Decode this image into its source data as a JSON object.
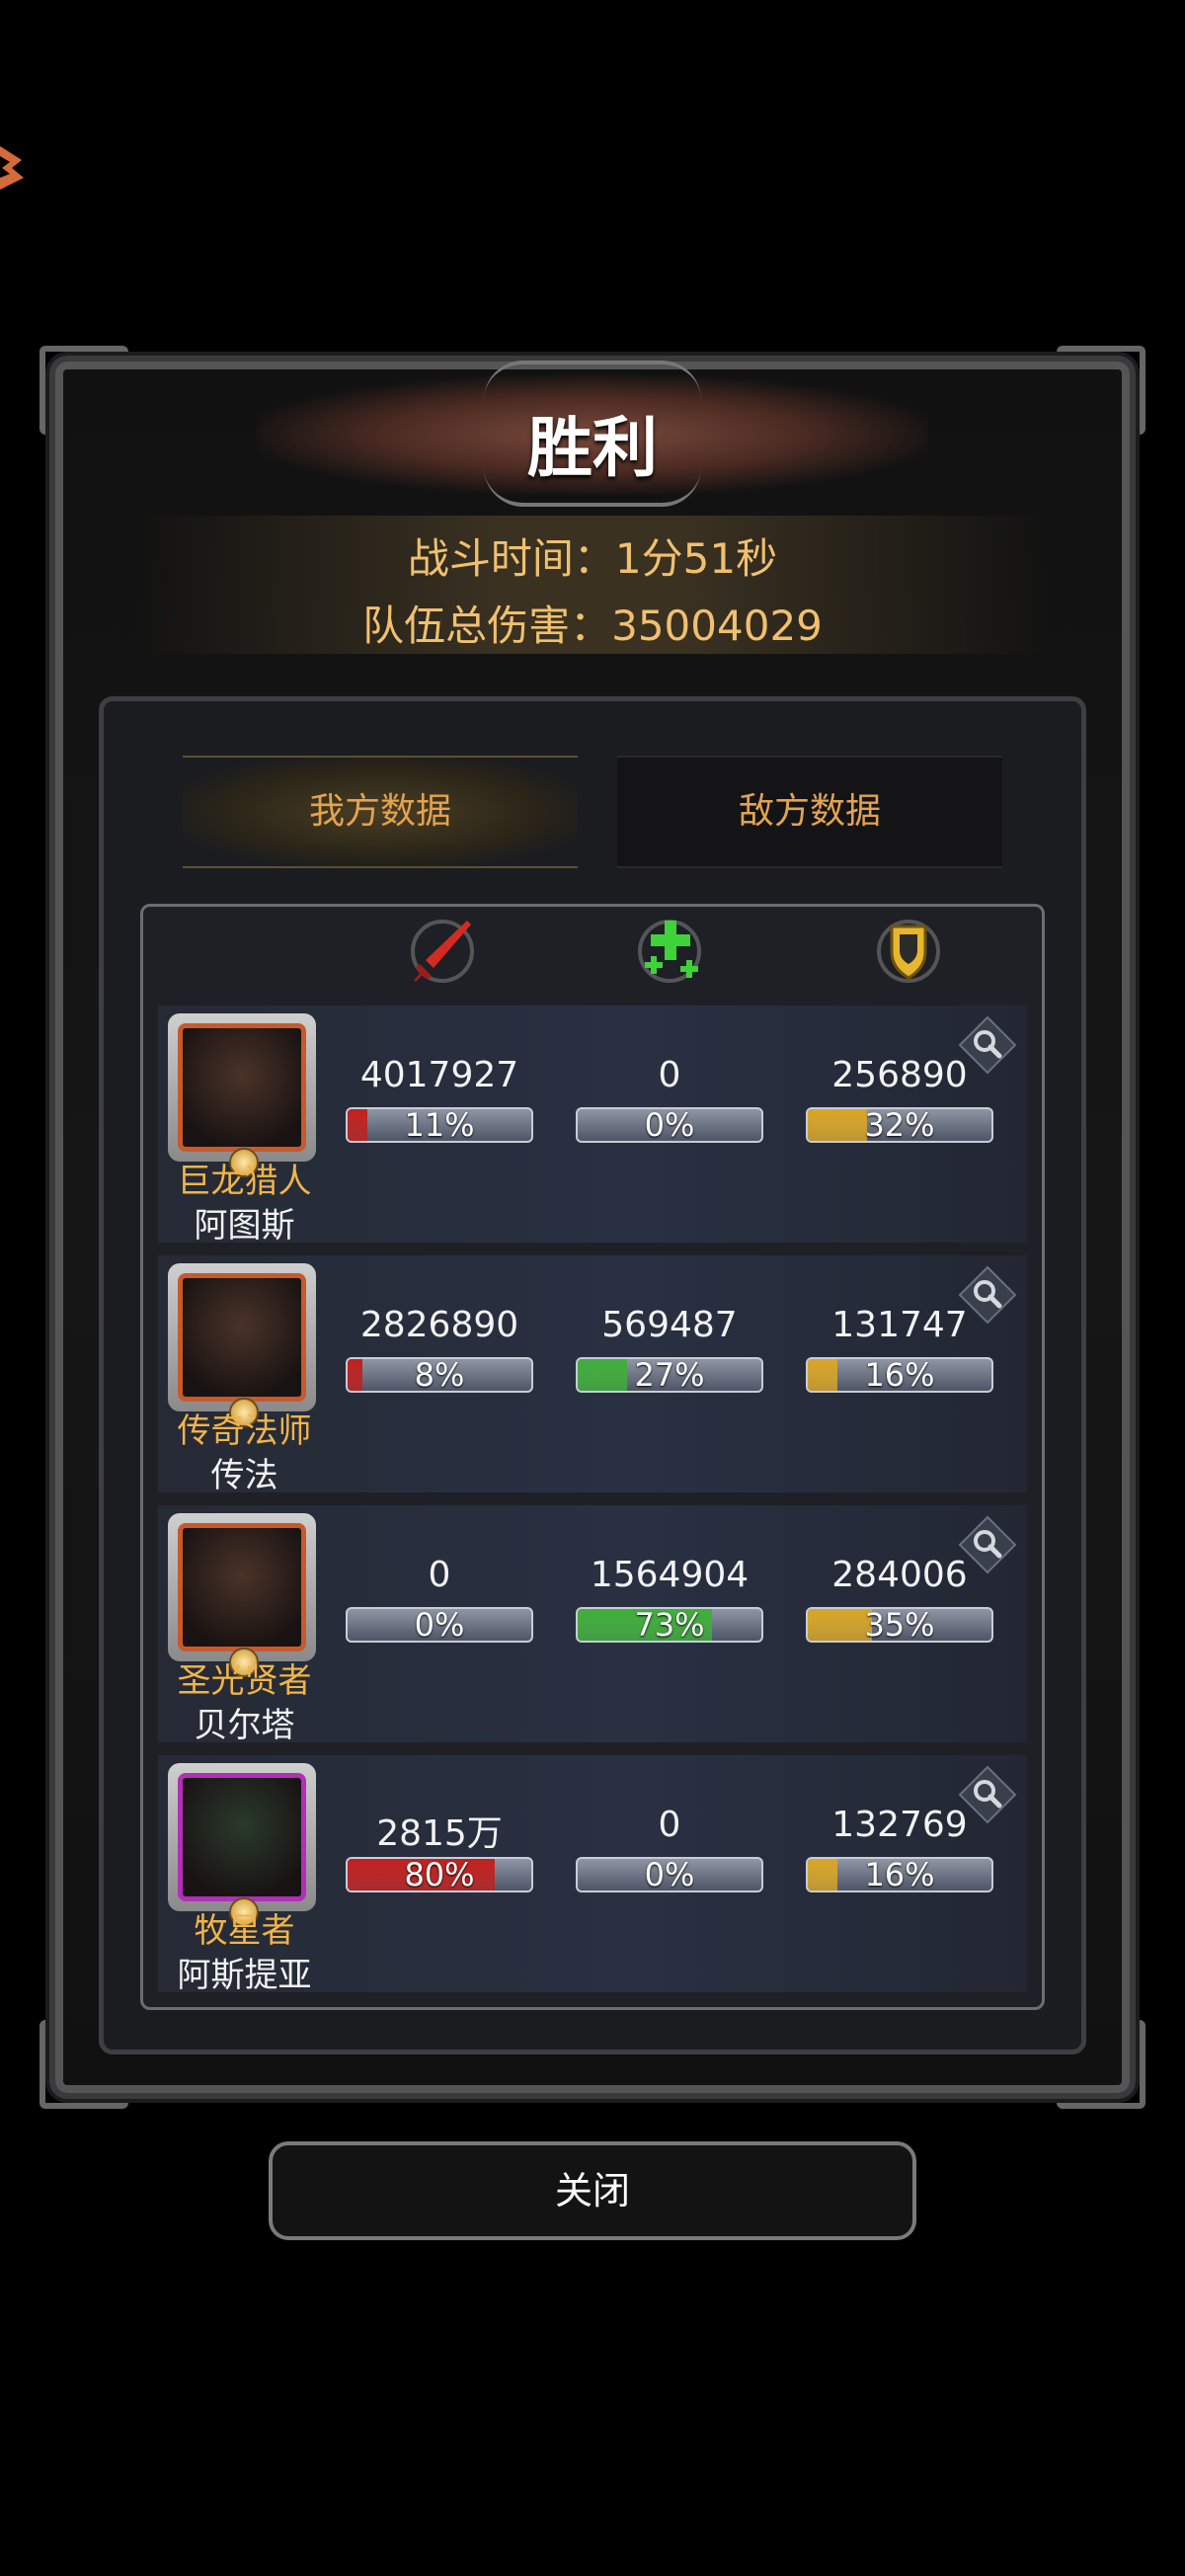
{
  "title": "胜利",
  "battle_time": "战斗时间：1分51秒",
  "total_damage": "队伍总伤害：35004029",
  "tabs": {
    "ours": "我方数据",
    "enemy": "敌方数据"
  },
  "header_icons": [
    "sword-icon",
    "heal-cross-icon",
    "shield-icon"
  ],
  "colors": {
    "damage": "#c0201e",
    "heal": "#3fae3a",
    "shield": "#d8a526",
    "title_gold": "#f0c070"
  },
  "heroes": [
    {
      "class": "巨龙猎人",
      "name": "阿图斯",
      "frame": "orange",
      "damage": {
        "value": "4017927",
        "pct_label": "11%",
        "pct": 11
      },
      "heal": {
        "value": "0",
        "pct_label": "0%",
        "pct": 0
      },
      "shield": {
        "value": "256890",
        "pct_label": "32%",
        "pct": 32
      }
    },
    {
      "class": "传奇法师",
      "name": "传法",
      "frame": "orange",
      "damage": {
        "value": "2826890",
        "pct_label": "8%",
        "pct": 8
      },
      "heal": {
        "value": "569487",
        "pct_label": "27%",
        "pct": 27
      },
      "shield": {
        "value": "131747",
        "pct_label": "16%",
        "pct": 16
      }
    },
    {
      "class": "圣光贤者",
      "name": "贝尔塔",
      "frame": "orange",
      "damage": {
        "value": "0",
        "pct_label": "0%",
        "pct": 0
      },
      "heal": {
        "value": "1564904",
        "pct_label": "73%",
        "pct": 73
      },
      "shield": {
        "value": "284006",
        "pct_label": "35%",
        "pct": 35
      }
    },
    {
      "class": "牧星者",
      "name": "阿斯提亚",
      "frame": "purple",
      "damage": {
        "value": "2815万",
        "pct_label": "80%",
        "pct": 80
      },
      "heal": {
        "value": "0",
        "pct_label": "0%",
        "pct": 0
      },
      "shield": {
        "value": "132769",
        "pct_label": "16%",
        "pct": 16
      }
    }
  ],
  "close_label": "关闭"
}
